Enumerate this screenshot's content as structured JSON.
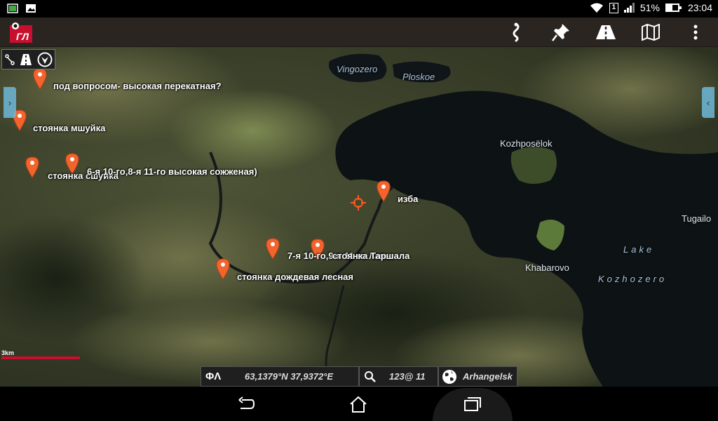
{
  "status_bar": {
    "sim_number": "1",
    "battery_percent": "51%",
    "battery_level": 0.51,
    "time": "23:04",
    "icons": [
      "gallery-icon",
      "image-icon",
      "wifi-icon",
      "sim-icon",
      "signal-icon",
      "battery-icon"
    ]
  },
  "app_bar": {
    "logo_text": "ГЛ",
    "icons": [
      "route-icon",
      "pin-icon",
      "road-icon",
      "map-icon",
      "overflow-menu-icon"
    ]
  },
  "map": {
    "place_labels": {
      "vingozero": "Vingozero",
      "ploskoe": "Ploskoe",
      "kozhposelok": "Kozhposëlok",
      "tugailo": "Tugailo",
      "khabarovo": "Khabarovo",
      "lake": "Lake",
      "kozhozero": "Kozhozero"
    },
    "waypoints": [
      "под вопросом- высокая перекатная?",
      "стоянка мшуйка",
      "стоянка сшуйка",
      "6-я 10-го,8-я 11-го высокая сожженая)",
      "изба",
      "7-я 10-го,9-я 11-го лавы",
      "стоянка Таршала",
      "стоянка дождевая лесная"
    ],
    "scale_label": "3km"
  },
  "info_bar": {
    "coord_symbol": "ΦΛ",
    "coordinates": "63,1379°N 37,9372°E",
    "zoom": "123@ 11",
    "region": "Arhangelsk"
  },
  "nav_bar": {
    "icons": [
      "back-icon",
      "home-icon",
      "recents-icon"
    ]
  },
  "colors": {
    "app_bar": "#2b2522",
    "pin": "#f2642c",
    "scale_bar": "#c8102e",
    "side_tab": "#6eb8d8"
  }
}
